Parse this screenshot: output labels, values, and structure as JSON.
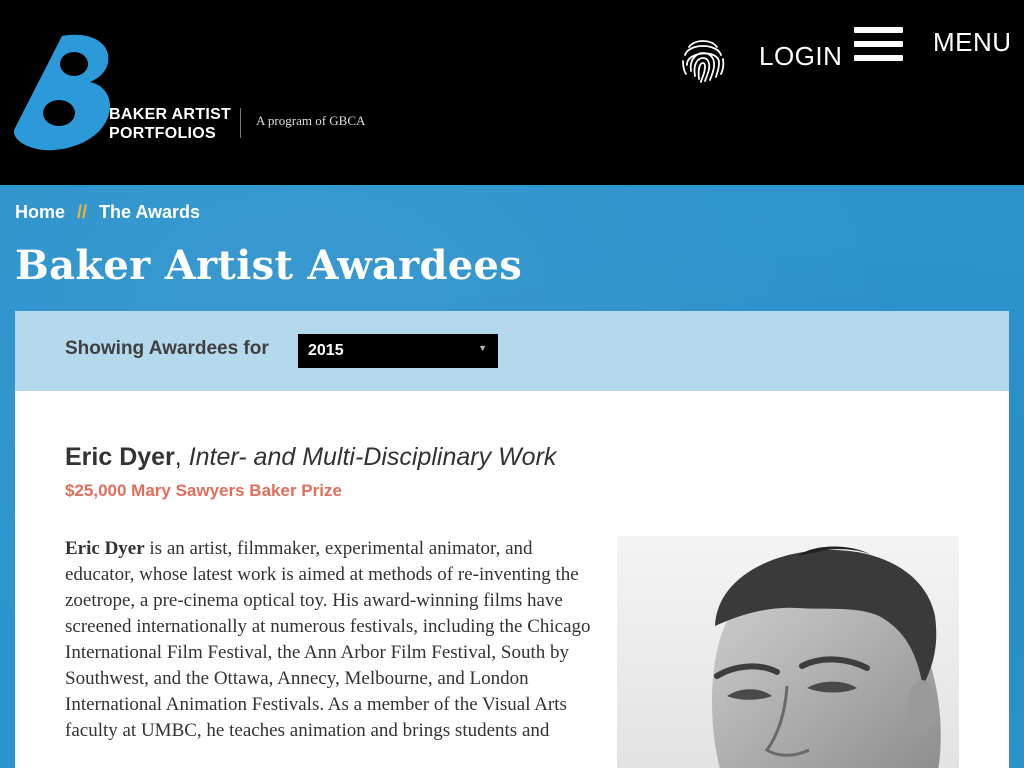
{
  "header": {
    "brand_line1": "BAKER ARTIST",
    "brand_line2": "PORTFOLIOS",
    "tagline": "A program of GBCA",
    "login_label": "LOGIN",
    "menu_label": "MENU"
  },
  "breadcrumb": {
    "home": "Home",
    "separator": "//",
    "current": "The Awards"
  },
  "page_title": "Baker Artist Awardees",
  "filter": {
    "label": "Showing Awardees for",
    "selected_year": "2015"
  },
  "awardee": {
    "name": "Eric Dyer",
    "comma": ",",
    "discipline": "Inter- and Multi-Disciplinary Work",
    "prize": "$25,000 Mary Sawyers Baker Prize",
    "bio_lead": "Eric Dyer",
    "bio_rest": " is an artist, filmmaker, experimental animator, and educator, whose latest work is aimed at methods of re-inventing the zoetrope, a pre-cinema optical toy. His award-winning films have screened internationally at numerous festivals, including the Chicago International Film Festival, the Ann Arbor Film Festival, South by Southwest, and the Ottawa, Annecy, Melbourne, and London International Animation Festivals. As a member of the Visual Arts faculty at UMBC, he teaches animation and brings students and"
  },
  "colors": {
    "header_bg": "#000000",
    "hero_blue": "#2c93cc",
    "filter_bg": "#b4d8ec",
    "breadcrumb_sep": "#f0b43a",
    "prize_red": "#e06e5b",
    "logo_blue": "#2c9ad8"
  },
  "icons": {
    "logo": "baker-b-logo",
    "login": "fingerprint-icon",
    "menu": "hamburger-icon",
    "select": "caret-down-icon"
  }
}
